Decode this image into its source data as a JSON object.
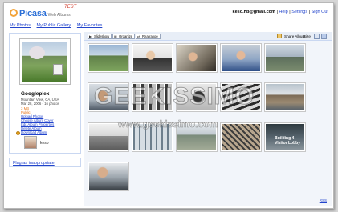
{
  "header": {
    "logo_name": "Picasa",
    "logo_sub": "Web Albums",
    "logo_tag": "TEST",
    "user_email": "keso.hb@gmail.com",
    "separator": "|",
    "links": [
      "Help",
      "Settings",
      "Sign Out"
    ]
  },
  "nav": {
    "items": [
      "My Photos",
      "My Public Gallery",
      "My Favorites"
    ]
  },
  "album": {
    "title": "Googleplex",
    "location": "Mountain View, CA, USA",
    "meta": "Mar 28, 2006 - 16 photos",
    "size": "3 MB",
    "visibility": "Public",
    "actions": [
      "Upload Photos",
      "Choose Album Cover",
      "Edit Album Properties",
      "Delete Album",
      "Download Album"
    ],
    "owner": "keso"
  },
  "flag": {
    "label": "Flag as inappropriate"
  },
  "toolbar": {
    "slideshow": "Slideshow",
    "organize": "Organize",
    "rearrange": "Rearrange",
    "share": "Share Album",
    "size_label": "Size"
  },
  "photos": {
    "count": 16,
    "captions": {
      "p15": "Building 4\nVisitor Lobby"
    }
  },
  "watermark": {
    "brand": "GEEKISSIMO",
    "url": "www.geekissimo.com"
  },
  "footer": {
    "rss": "RSS"
  },
  "colors": {
    "link": "#2244cc",
    "panel_border": "#c9d7f1",
    "toolbar_bg": "#e8eef7",
    "accent_orange": "#e6751a"
  }
}
